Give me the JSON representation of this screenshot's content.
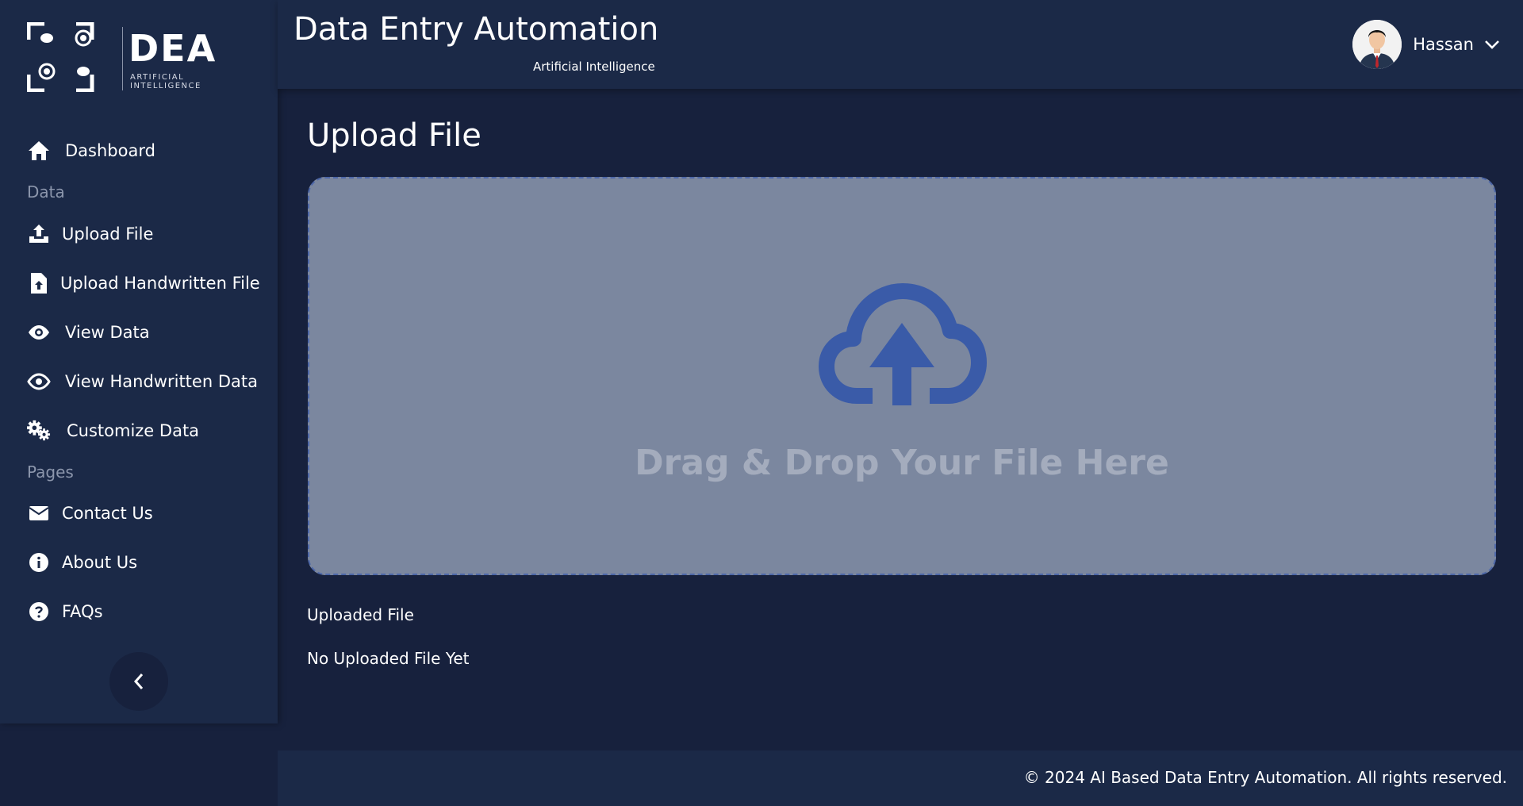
{
  "brand": {
    "logo_text": "DEA",
    "logo_subtext": "ARTIFICIAL INTELLIGENCE"
  },
  "header": {
    "title": "Data Entry Automation",
    "subtitle": "Artificial Intelligence"
  },
  "user": {
    "name": "Hassan",
    "avatar_icon": "user-avatar",
    "menu_icon": "chevron-down-icon"
  },
  "sidebar": {
    "items": [
      {
        "label": "Dashboard",
        "icon": "home-icon"
      },
      {
        "label": "Upload File",
        "icon": "upload-icon"
      },
      {
        "label": "Upload Handwritten File",
        "icon": "file-upload-icon"
      },
      {
        "label": "View Data",
        "icon": "eye-icon"
      },
      {
        "label": "View Handwritten Data",
        "icon": "eye-outline-icon"
      },
      {
        "label": "Customize Data",
        "icon": "gears-icon"
      },
      {
        "label": "Contact Us",
        "icon": "envelope-icon"
      },
      {
        "label": "About Us",
        "icon": "info-circle-icon"
      },
      {
        "label": "FAQs",
        "icon": "question-circle-icon"
      }
    ],
    "sections": {
      "data": "Data",
      "pages": "Pages"
    },
    "collapse_icon": "chevron-left-icon"
  },
  "main": {
    "title": "Upload File",
    "dropzone_text": "Drag & Drop Your File Here",
    "dropzone_icon": "cloud-upload-icon",
    "uploaded_label": "Uploaded File",
    "uploaded_empty": "No Uploaded File Yet"
  },
  "footer": {
    "copyright": "© 2024 AI Based Data Entry Automation. All rights reserved."
  },
  "colors": {
    "background": "#17213d",
    "panel": "#1b2947",
    "dropzone": "#7b879f",
    "accent": "#3a5ba8"
  }
}
